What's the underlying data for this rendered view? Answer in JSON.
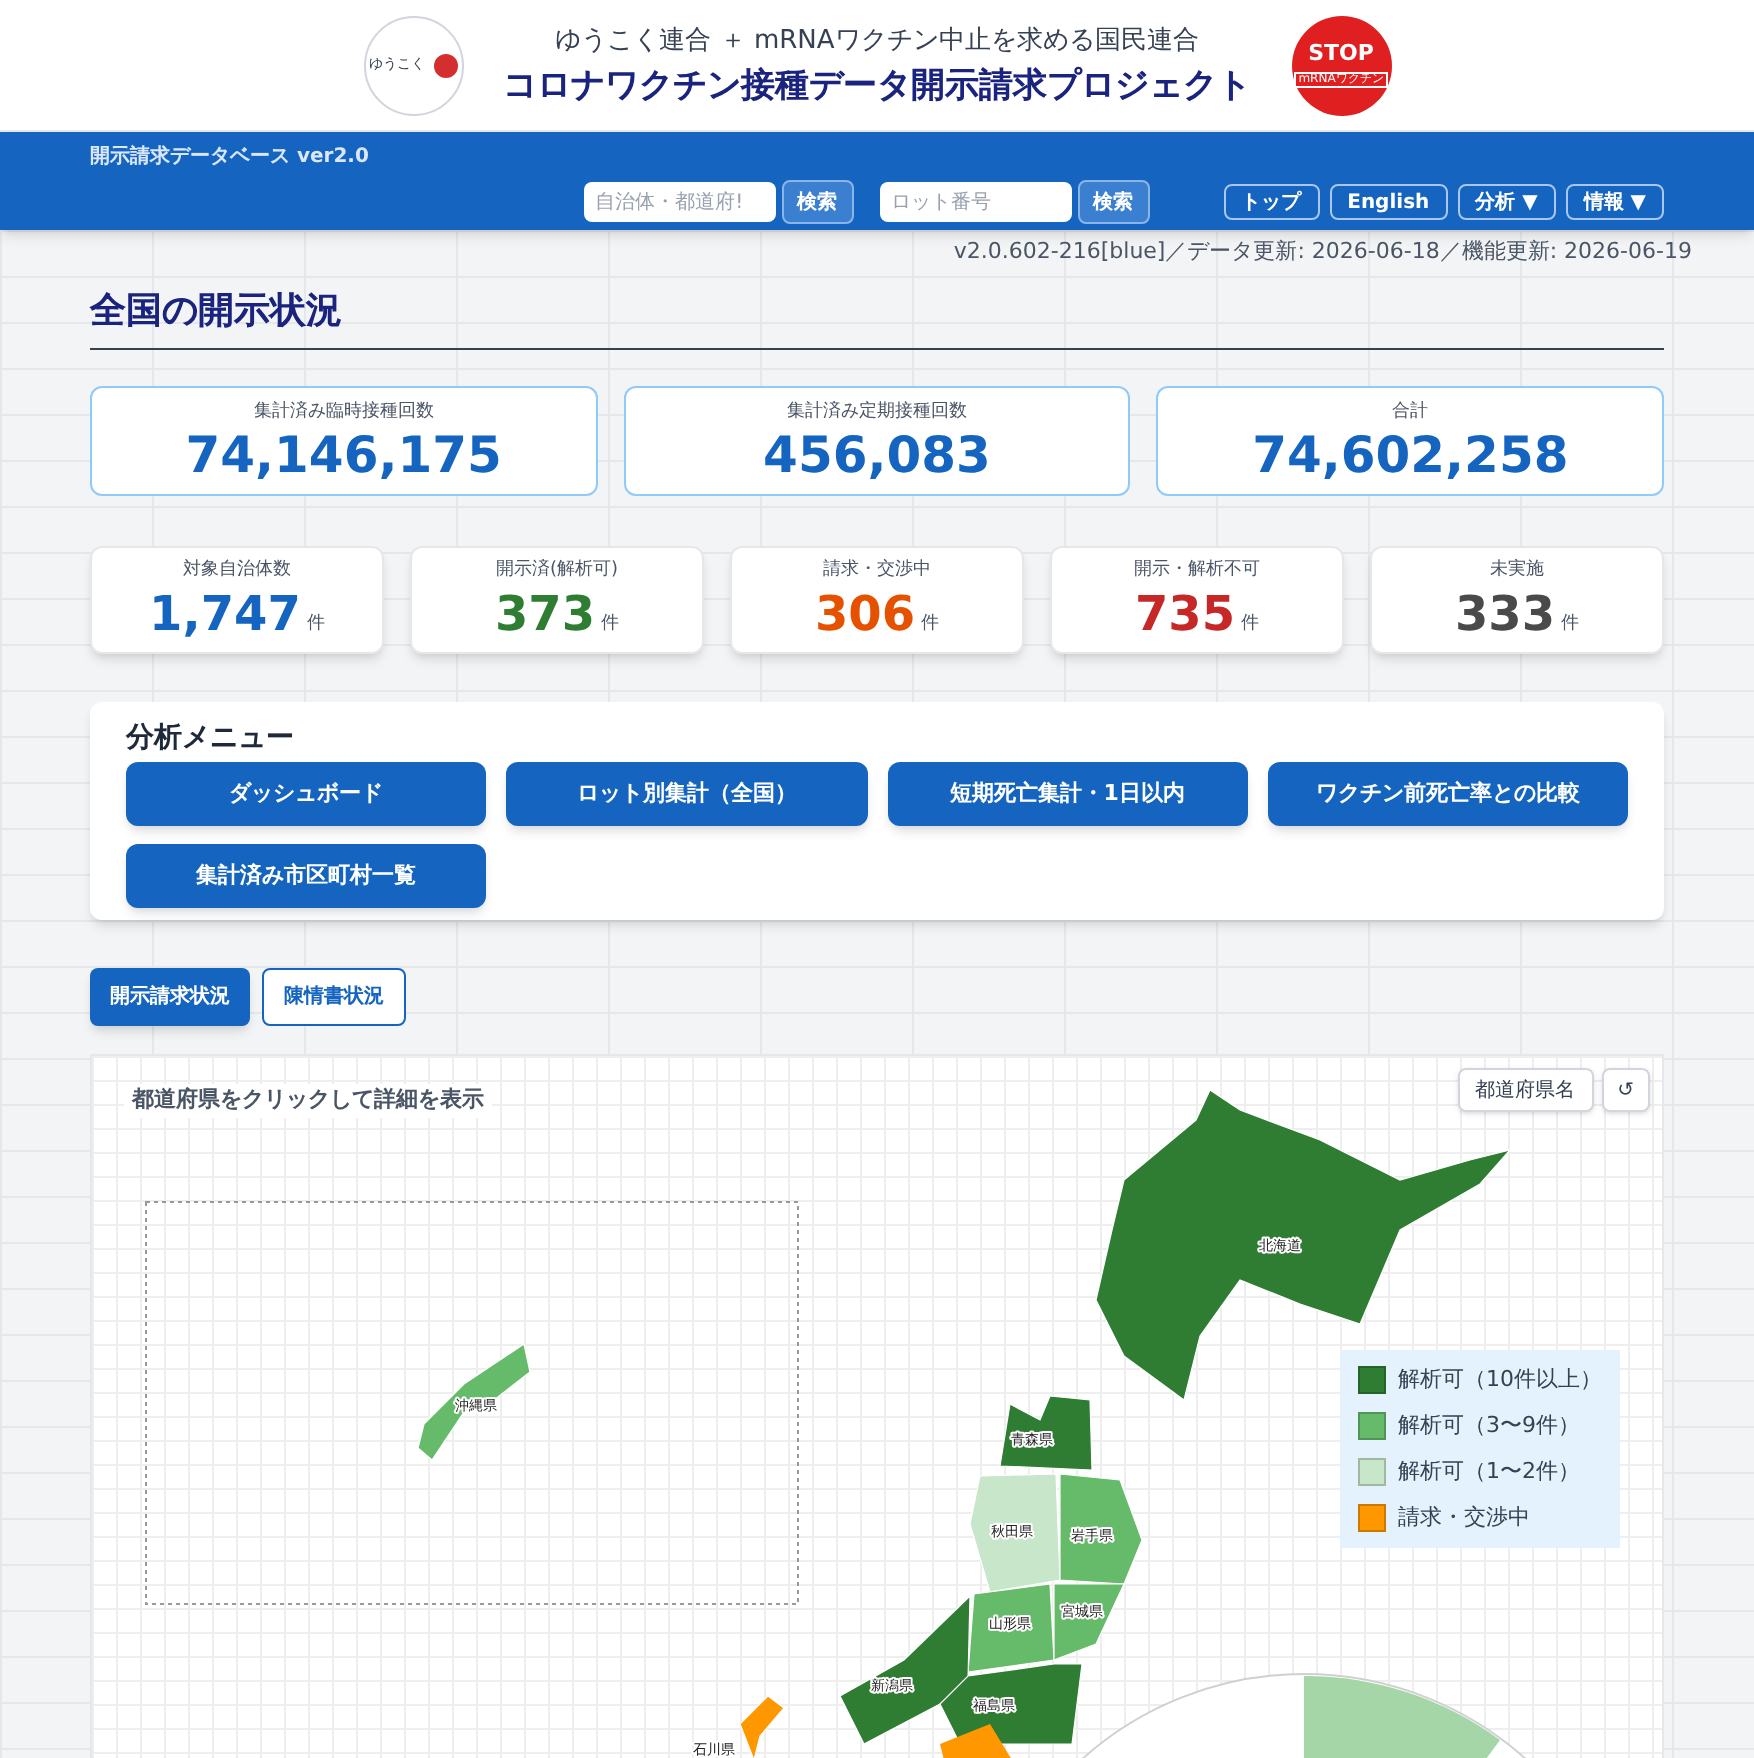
{
  "header": {
    "subtitle": "ゆうこく連合 ＋ mRNAワクチン中止を求める国民連合",
    "title": "コロナワクチン接種データ開示請求プロジェクト",
    "logo_text": "ゆうこく",
    "stop_badge": {
      "top": "STOP",
      "bottom": "mRNAワクチン"
    }
  },
  "navbar": {
    "brand": "開示請求データベース ver2.0",
    "search_fields": [
      {
        "placeholder": "自治体・都道府!",
        "button": "検索"
      },
      {
        "placeholder": "ロット番号",
        "button": "検索"
      }
    ],
    "links": [
      {
        "label": "トップ"
      },
      {
        "label": "English"
      },
      {
        "label": "分析 ▼"
      },
      {
        "label": "情報 ▼"
      }
    ]
  },
  "version_line": "v2.0.602-216[blue]／データ更新: 2026-06-18／機能更新: 2026-06-19",
  "page_title": "全国の開示状況",
  "totals": [
    {
      "label": "集計済み臨時接種回数",
      "value": "74,146,175"
    },
    {
      "label": "集計済み定期接種回数",
      "value": "456,083"
    },
    {
      "label": "合計",
      "value": "74,602,258"
    }
  ],
  "status_counts": [
    {
      "label": "対象自治体数",
      "value": "1,747",
      "unit": "件",
      "color": "#1565c0"
    },
    {
      "label": "開示済(解析可)",
      "value": "373",
      "unit": "件",
      "color": "#2e7d32"
    },
    {
      "label": "請求・交渉中",
      "value": "306",
      "unit": "件",
      "color": "#e65100"
    },
    {
      "label": "開示・解析不可",
      "value": "735",
      "unit": "件",
      "color": "#c62828"
    },
    {
      "label": "未実施",
      "value": "333",
      "unit": "件",
      "color": "#4a4a4a"
    }
  ],
  "analysis_menu": {
    "title": "分析メニュー",
    "buttons": [
      "ダッシュボード",
      "ロット別集計（全国）",
      "短期死亡集計・1日以内",
      "ワクチン前死亡率との比較",
      "集計済み市区町村一覧"
    ]
  },
  "tabs": [
    {
      "label": "開示請求状況",
      "selected": true
    },
    {
      "label": "陳情書状況",
      "selected": false
    }
  ],
  "map": {
    "hint": "都道府県をクリックして詳細を表示",
    "toggle_button": "都道府県名",
    "reset_button": "↺",
    "legend": [
      {
        "label": "解析可（10件以上）",
        "color": "#2e7d32"
      },
      {
        "label": "解析可（3〜9件）",
        "color": "#66bb6a"
      },
      {
        "label": "解析可（1〜2件）",
        "color": "#c8e6c9"
      },
      {
        "label": "請求・交渉中",
        "color": "#ff9800"
      }
    ],
    "prefectures": [
      {
        "name": "北海道",
        "color": "#2e7d32"
      },
      {
        "name": "青森県",
        "color": "#2e7d32"
      },
      {
        "name": "秋田県",
        "color": "#c8e6c9"
      },
      {
        "name": "岩手県",
        "color": "#66bb6a"
      },
      {
        "name": "山形県",
        "color": "#66bb6a"
      },
      {
        "name": "宮城県",
        "color": "#66bb6a"
      },
      {
        "name": "新潟県",
        "color": "#2e7d32"
      },
      {
        "name": "福島県",
        "color": "#2e7d32"
      },
      {
        "name": "石川県",
        "color": "#ff9800"
      },
      {
        "name": "沖縄県",
        "color": "#66bb6a"
      }
    ]
  }
}
